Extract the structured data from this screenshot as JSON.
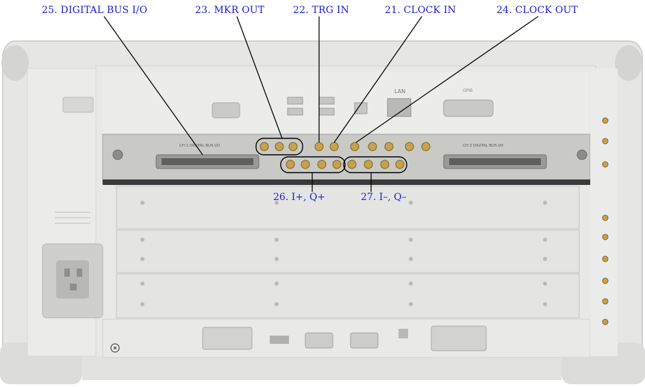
{
  "callouts": {
    "digital_bus_io": "25. DIGITAL BUS I/O",
    "mkr_out": "23. MKR OUT",
    "trg_in": "22. TRG IN",
    "clock_in": "21. CLOCK IN",
    "clock_out": "24. CLOCK OUT",
    "i_plus_q_plus": "26. I+, Q+",
    "i_minus_q_minus": "27. I–, Q–"
  },
  "panel_labels": {
    "ch1_bus": "CH 1 DIGITAL BUS I/O",
    "ch2_bus": "CH 2 DIGITAL BUS I/O",
    "lan": "LAN",
    "gpib": "GPIB"
  },
  "colors": {
    "callout_text": "#1a1ad6",
    "leader_line": "#000000",
    "chassis": "#e3e3e1",
    "module_plate": "#c9cac6",
    "connector_gold": "#c7a24a"
  }
}
